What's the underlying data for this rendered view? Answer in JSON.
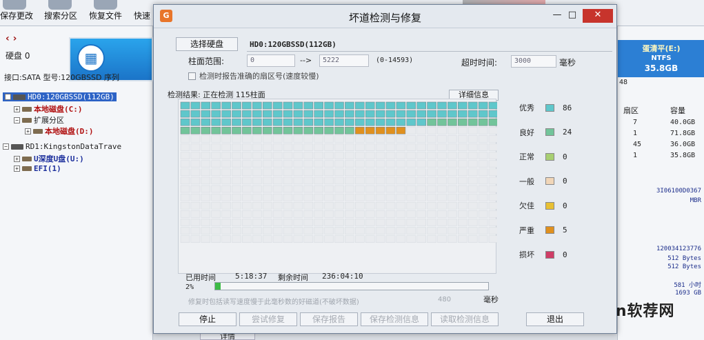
{
  "toolbar": {
    "items": [
      "保存更改",
      "搜索分区",
      "恢复文件",
      "快速"
    ]
  },
  "left_panel": {
    "nav": "‹ ›",
    "disk_label": "硬盘 0",
    "interface_line": "接口:SATA  型号:120GBSSD  序列",
    "tree": [
      {
        "expander": "−",
        "icon": "disk",
        "label": "HD0:120GBSSD(112GB)",
        "style": "sel"
      },
      {
        "expander": "+",
        "icon": "part",
        "label": "本地磁盘(C:)",
        "style": "red"
      },
      {
        "expander": "−",
        "icon": "part",
        "label": "扩展分区",
        "style": "plain"
      },
      {
        "expander": "+",
        "icon": "part",
        "label": "本地磁盘(D:)",
        "style": "red"
      },
      {
        "expander": "−",
        "icon": "disk",
        "label": "RD1:KingstonDataTrave",
        "style": "plain"
      },
      {
        "expander": "+",
        "icon": "part",
        "label": "U深度U盘(U:)",
        "style": "blue"
      },
      {
        "expander": "+",
        "icon": "part",
        "label": "EFI(1)",
        "style": "blue"
      }
    ]
  },
  "right_panel": {
    "volume": {
      "name": "蛋清平(E:)",
      "fs": "NTFS",
      "size": "35.8GB"
    },
    "header_num": "48",
    "header_sector": "扇区",
    "header_capacity": "容量",
    "rows": [
      {
        "sector": "7",
        "capacity": "40.0GB"
      },
      {
        "sector": "1",
        "capacity": "71.8GB"
      },
      {
        "sector": "45",
        "capacity": "36.0GB"
      },
      {
        "sector": "1",
        "capacity": "35.8GB"
      }
    ],
    "info": [
      "3I06100D0367",
      "MBR",
      "120034123776",
      "512 Bytes",
      "512 Bytes",
      "581 小时",
      "1693 GB"
    ]
  },
  "bottom_button": "详情",
  "watermark": "rjtj.cn软荐网",
  "dialog": {
    "title": "坏道检测与修复",
    "icon_letter": "G",
    "select_disk_button": "选择硬盘",
    "disk_name": "HD0:120GBSSD(112GB)",
    "cyl_label": "柱面范围:",
    "cyl_from": "0",
    "arrow": "-->",
    "cyl_to": "5222",
    "cyl_range": "(0-14593)",
    "timeout_label": "超时时间:",
    "timeout_value": "3000",
    "timeout_unit": "毫秒",
    "report_sector_label": "检测时报告准确的扇区号(速度较慢)",
    "result_label": "检测结果: 正在检测 115柱面",
    "detail_button": "详细信息",
    "legend": [
      {
        "name": "优秀",
        "color": "#5fc7cb",
        "count": "86"
      },
      {
        "name": "良好",
        "color": "#72c49a",
        "count": "24"
      },
      {
        "name": "正常",
        "color": "#a8cf72",
        "count": "0"
      },
      {
        "name": "一般",
        "color": "#f1d6b8",
        "count": "0"
      },
      {
        "name": "欠佳",
        "color": "#e8c033",
        "count": "0"
      },
      {
        "name": "严重",
        "color": "#e0901e",
        "count": "5"
      },
      {
        "name": "损坏",
        "color": "#cf3d66",
        "count": "0"
      }
    ],
    "elapsed_label": "已用时间",
    "elapsed_value": "5:18:37",
    "remaining_label": "剩余时间",
    "remaining_value": "236:04:10",
    "progress_text": "2%",
    "progress": 0.02,
    "repair_label": "修复时包括读写速度慢于此毫秒数的好磁道(不破坏数据)",
    "repair_value": "480",
    "repair_unit": "毫秒",
    "buttons": {
      "stop": "停止",
      "try_repair": "尝试修复",
      "save_report": "保存报告",
      "save_info": "保存检测信息",
      "read_info": "读取检测信息",
      "exit": "退出"
    }
  }
}
